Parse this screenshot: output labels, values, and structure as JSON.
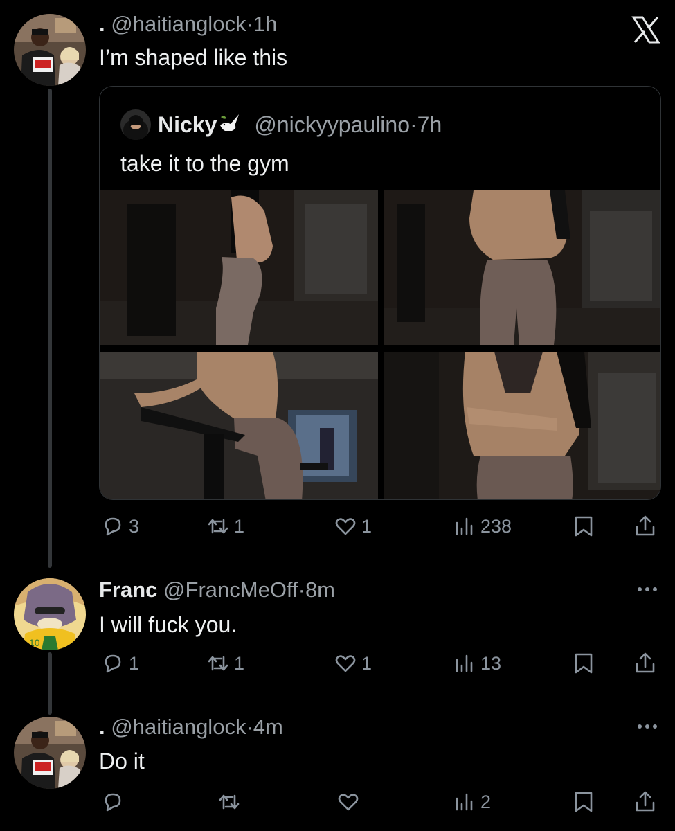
{
  "app": {
    "logo_icon": "x-logo-icon"
  },
  "tweets": [
    {
      "prefix": ".",
      "handle": "@haitianglock",
      "dot": "·",
      "time": "1h",
      "text": "I’m shaped like this",
      "quote": {
        "name": "Nicky",
        "badge_icon": "dove-icon",
        "handle": "@nickyypaulino",
        "dot": "·",
        "time": "7h",
        "text": "take it to the gym",
        "media_count": 4
      },
      "actions": {
        "replies": "3",
        "reposts": "1",
        "likes": "1",
        "views": "238"
      }
    },
    {
      "name": "Franc",
      "handle": "@FrancMeOff",
      "dot": "·",
      "time": "8m",
      "text": "I will fuck you.",
      "actions": {
        "replies": "1",
        "reposts": "1",
        "likes": "1",
        "views": "13"
      }
    },
    {
      "prefix": ".",
      "handle": "@haitianglock",
      "dot": "·",
      "time": "4m",
      "text": "Do it",
      "actions": {
        "replies": "",
        "reposts": "",
        "likes": "",
        "views": "2"
      }
    }
  ],
  "colors": {
    "background": "#000000",
    "text": "#e7e9ea",
    "muted": "#8b949e",
    "border": "#2f3336"
  }
}
